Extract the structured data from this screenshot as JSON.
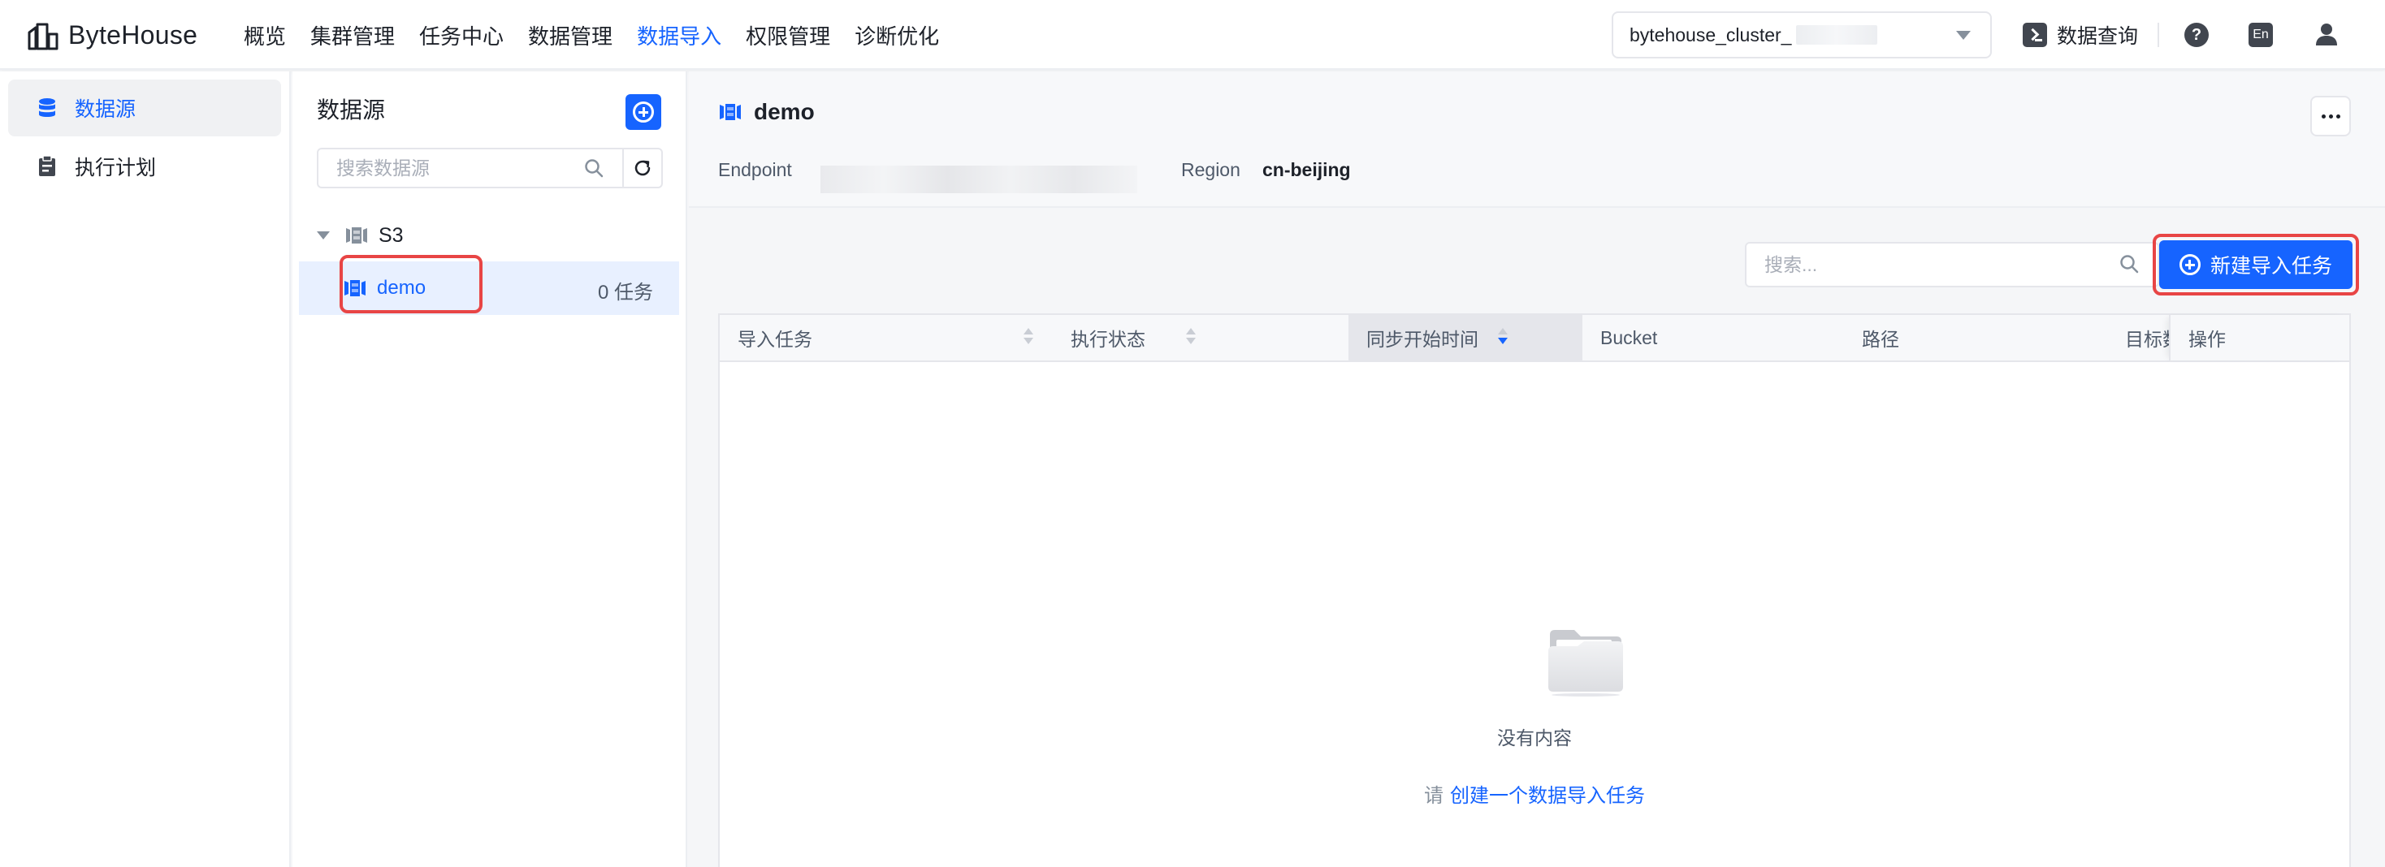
{
  "brand": {
    "name": "ByteHouse"
  },
  "nav": {
    "items": [
      {
        "label": "概览",
        "active": false
      },
      {
        "label": "集群管理",
        "active": false
      },
      {
        "label": "任务中心",
        "active": false
      },
      {
        "label": "数据管理",
        "active": false
      },
      {
        "label": "数据导入",
        "active": true
      },
      {
        "label": "权限管理",
        "active": false
      },
      {
        "label": "诊断优化",
        "active": false
      }
    ]
  },
  "cluster": {
    "value": "bytehouse_cluster_"
  },
  "header_actions": {
    "query_label": "数据查询",
    "help": "?",
    "lang": "En"
  },
  "sidebar": {
    "items": [
      {
        "label": "数据源",
        "icon": "database-icon",
        "active": true
      },
      {
        "label": "执行计划",
        "icon": "clipboard-icon",
        "active": false
      }
    ]
  },
  "datasource": {
    "title": "数据源",
    "search_placeholder": "搜索数据源",
    "tree": {
      "group": "S3",
      "items": [
        {
          "label": "demo",
          "count": "0 任务",
          "selected": true
        }
      ]
    }
  },
  "detail": {
    "title": "demo",
    "endpoint_label": "Endpoint",
    "region_label": "Region",
    "region_value": "cn-beijing",
    "search_placeholder": "搜索...",
    "new_task_label": "新建导入任务",
    "table": {
      "columns": [
        "导入任务",
        "执行状态",
        "同步开始时间",
        "Bucket",
        "路径",
        "目标数",
        "操作"
      ]
    },
    "empty": {
      "text": "没有内容",
      "hint_prefix": "请",
      "hint_link": "创建一个数据导入任务"
    }
  },
  "colors": {
    "primary": "#1664ff",
    "highlight": "#e84545",
    "selected_row": "#e8f0ff"
  }
}
